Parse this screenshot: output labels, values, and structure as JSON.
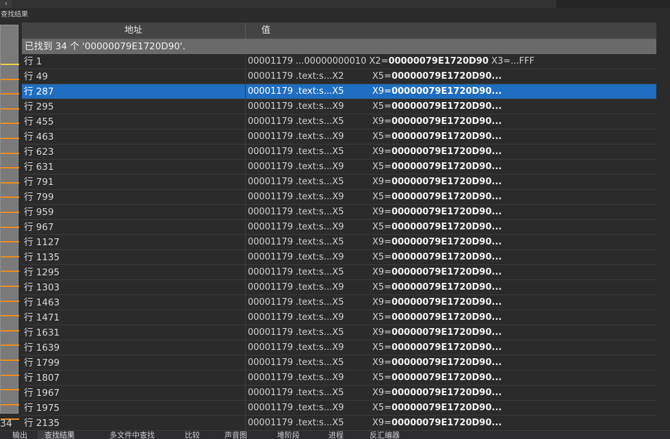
{
  "window": {
    "panel_title": "查找结果"
  },
  "overview": {
    "count_label": "34"
  },
  "grid": {
    "headers": {
      "address": "地址",
      "value": "值"
    },
    "summary": "已找到 34 个 '00000079E1720D90'.",
    "first_row": {
      "address": "行 1",
      "v_addr": "00001179",
      "v_mid": "...00000000010 X2=",
      "v_bold": "00000079E1720D90",
      "v_tail": " X3=...FFF"
    },
    "rows": [
      {
        "address": "行 49",
        "seg": ".text:s...X2",
        "reg": "X5="
      },
      {
        "address": "行 287",
        "seg": ".text:s...X5",
        "reg": "X9="
      },
      {
        "address": "行 295",
        "seg": ".text:s...X9",
        "reg": "X5="
      },
      {
        "address": "行 455",
        "seg": ".text:s...X5",
        "reg": "X9="
      },
      {
        "address": "行 463",
        "seg": ".text:s...X9",
        "reg": "X5="
      },
      {
        "address": "行 623",
        "seg": ".text:s...X5",
        "reg": "X9="
      },
      {
        "address": "行 631",
        "seg": ".text:s...X9",
        "reg": "X5="
      },
      {
        "address": "行 791",
        "seg": ".text:s...X5",
        "reg": "X9="
      },
      {
        "address": "行 799",
        "seg": ".text:s...X9",
        "reg": "X5="
      },
      {
        "address": "行 959",
        "seg": ".text:s...X5",
        "reg": "X9="
      },
      {
        "address": "行 967",
        "seg": ".text:s...X9",
        "reg": "X5="
      },
      {
        "address": "行 1127",
        "seg": ".text:s...X5",
        "reg": "X9="
      },
      {
        "address": "行 1135",
        "seg": ".text:s...X9",
        "reg": "X5="
      },
      {
        "address": "行 1295",
        "seg": ".text:s...X5",
        "reg": "X9="
      },
      {
        "address": "行 1303",
        "seg": ".text:s...X9",
        "reg": "X5="
      },
      {
        "address": "行 1463",
        "seg": ".text:s...X5",
        "reg": "X9="
      },
      {
        "address": "行 1471",
        "seg": ".text:s...X9",
        "reg": "X5="
      },
      {
        "address": "行 1631",
        "seg": ".text:s...X5",
        "reg": "X9="
      },
      {
        "address": "行 1639",
        "seg": ".text:s...X9",
        "reg": "X5="
      },
      {
        "address": "行 1799",
        "seg": ".text:s...X5",
        "reg": "X9="
      },
      {
        "address": "行 1807",
        "seg": ".text:s...X9",
        "reg": "X5="
      },
      {
        "address": "行 1967",
        "seg": ".text:s...X5",
        "reg": "X9="
      },
      {
        "address": "行 1975",
        "seg": ".text:s...X9",
        "reg": "X5="
      },
      {
        "address": "行 2135",
        "seg": ".text:s...X5",
        "reg": "X9="
      }
    ],
    "value_addr": "00001179",
    "value_bold": "00000079E1720D90...",
    "selected_row_index": 1,
    "colors": {
      "selection": "#1f6ec1",
      "overview_mark": "#f08c1a"
    }
  },
  "bottom_tabs": [
    {
      "label": "输出"
    },
    {
      "label": "查找结果"
    },
    {
      "label": "多文件中查找"
    },
    {
      "label": "比较"
    },
    {
      "label": "声音图"
    },
    {
      "label": "堆阶段"
    },
    {
      "label": "进程"
    },
    {
      "label": "反汇编器"
    }
  ]
}
